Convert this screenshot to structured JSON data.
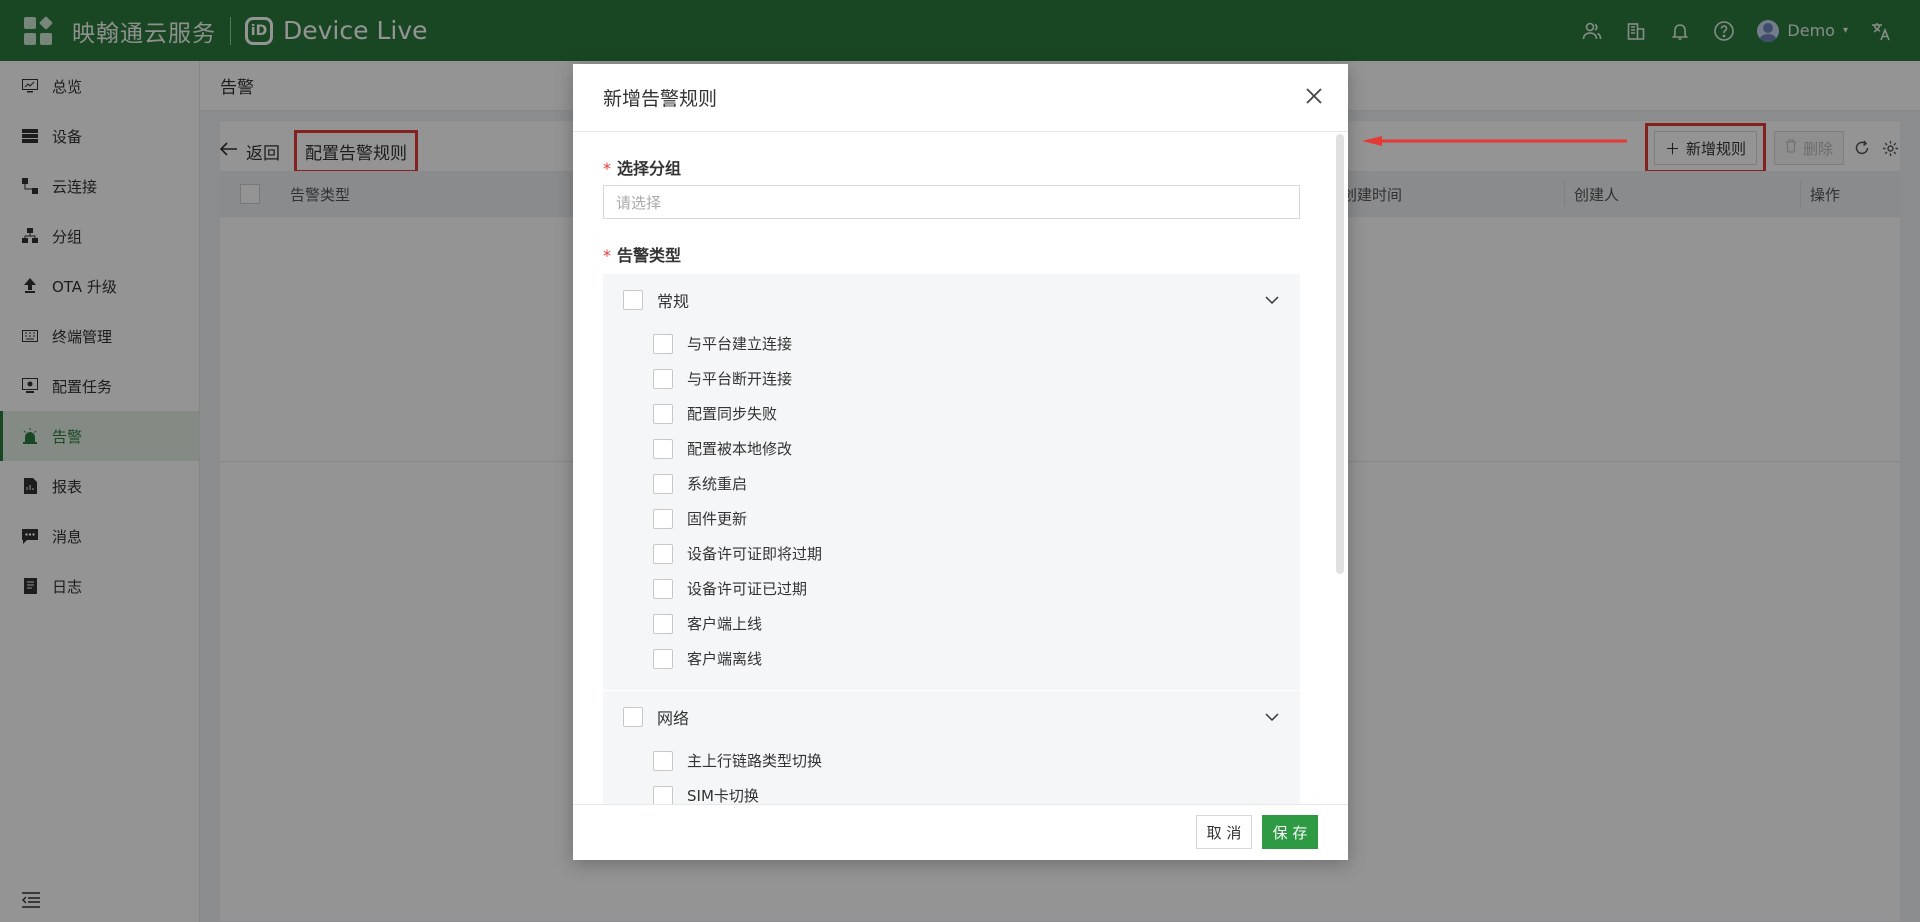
{
  "topbar": {
    "brand": "映翰通云服务",
    "logo_text": "iD",
    "product": "Device Live",
    "user": "Demo",
    "icons": [
      "apps-icon",
      "user-group-icon",
      "building-icon",
      "bell-icon",
      "help-icon",
      "translate-icon"
    ]
  },
  "sidebar": {
    "items": [
      {
        "label": "总览",
        "icon": "overview-icon"
      },
      {
        "label": "设备",
        "icon": "device-icon"
      },
      {
        "label": "云连接",
        "icon": "cloud-connect-icon"
      },
      {
        "label": "分组",
        "icon": "group-icon"
      },
      {
        "label": "OTA 升级",
        "icon": "upgrade-icon"
      },
      {
        "label": "终端管理",
        "icon": "keyboard-icon"
      },
      {
        "label": "配置任务",
        "icon": "config-task-icon"
      },
      {
        "label": "告警",
        "icon": "alarm-icon",
        "active": true
      },
      {
        "label": "报表",
        "icon": "report-icon"
      },
      {
        "label": "消息",
        "icon": "message-icon"
      },
      {
        "label": "日志",
        "icon": "log-icon"
      }
    ]
  },
  "page": {
    "title": "告警",
    "back_label": "返回",
    "current": "配置告警规则",
    "add_rule": "新增规则",
    "delete": "删除",
    "columns": [
      "告警类型",
      "创建时间",
      "创建人",
      "操作"
    ]
  },
  "modal": {
    "title": "新增告警规则",
    "group_field_label": "选择分组",
    "group_placeholder": "请选择",
    "type_field_label": "告警类型",
    "groups": [
      {
        "title": "常规",
        "items": [
          "与平台建立连接",
          "与平台断开连接",
          "配置同步失败",
          "配置被本地修改",
          "系统重启",
          "固件更新",
          "设备许可证即将过期",
          "设备许可证已过期",
          "客户端上线",
          "客户端离线"
        ]
      },
      {
        "title": "网络",
        "items": [
          "主上行链路类型切换",
          "SIM卡切换"
        ]
      }
    ],
    "cancel": "取 消",
    "save": "保 存"
  },
  "colors": {
    "brand_green": "#2b7a3d",
    "save_green": "#2e9a44",
    "highlight_red": "#e53935"
  }
}
